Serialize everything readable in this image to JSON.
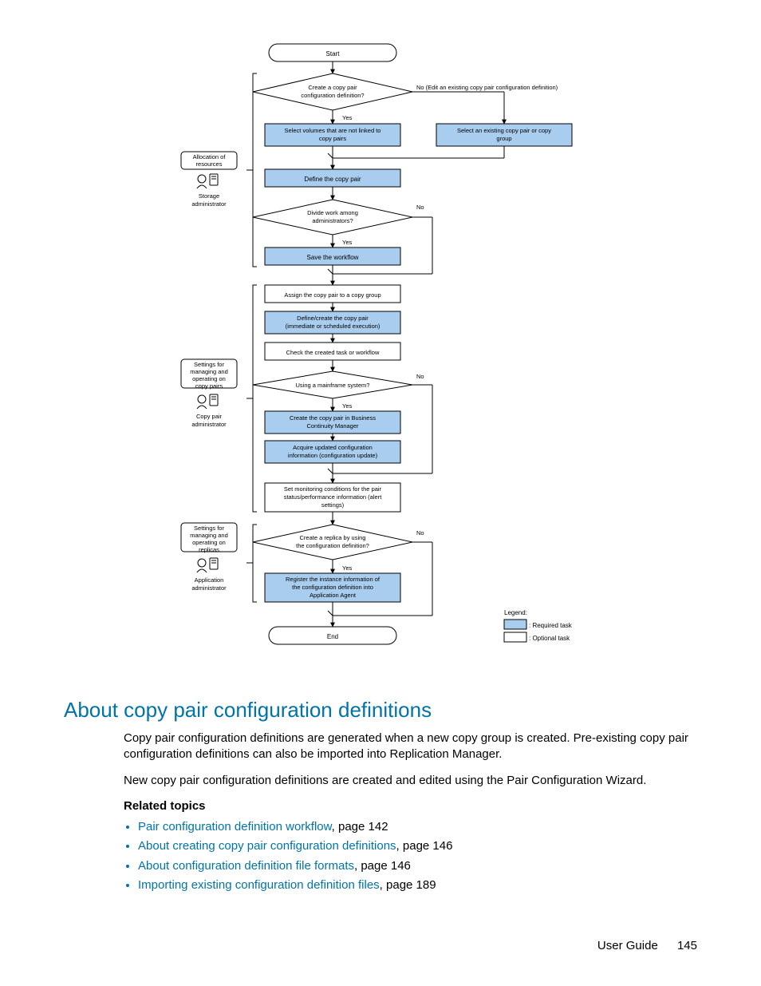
{
  "flowchart": {
    "start": "Start",
    "end": "End",
    "decisions": {
      "d1": "Create a copy pair\nconfiguration definition?",
      "d2": "Divide work among\nadministrators?",
      "d3": "Using a mainframe system?",
      "d4": "Create a replica by using\nthe configuration definition?"
    },
    "branch_labels": {
      "yes": "Yes",
      "no": "No"
    },
    "no_detail": "No (Edit an existing copy pair configuration definition)",
    "steps": {
      "s1": "Select volumes that are not linked to\ncopy pairs",
      "s2": "Select an existing copy pair or copy\ngroup",
      "s3": "Define the copy pair",
      "s4": "Save the workflow",
      "s5": "Assign the copy pair to a copy group",
      "s6": "Define/create the copy pair\n(immediate or scheduled execution)",
      "s7": "Check the created task or workflow",
      "s8": "Create the copy pair in Business\nContinuity Manager",
      "s9": "Acquire updated configuration\ninformation (configuration update)",
      "s10": "Set monitoring conditions for the pair\nstatus/performance information (alert\nsettings)",
      "s11": "Register the instance information of\nthe configuration definition into\nApplication Agent"
    },
    "roles": {
      "r1_box": "Allocation of\nresources",
      "r1_label": "Storage\nadministrator",
      "r2_box": "Settings for\nmanaging and\noperating on\ncopy pairs",
      "r2_label": "Copy pair\nadministrator",
      "r3_box": "Settings for\nmanaging and\noperating on\nreplicas",
      "r3_label": "Application\nadministrator"
    },
    "legend": {
      "title": "Legend:",
      "req": ": Required task",
      "opt": ": Optional task"
    }
  },
  "section": {
    "heading": "About copy pair configuration definitions",
    "p1": "Copy pair configuration definitions are generated when a new copy group is created. Pre-existing copy pair configuration definitions can also be imported into Replication Manager.",
    "p2": "New copy pair configuration definitions are created and edited using the Pair Configuration Wizard.",
    "related": "Related topics",
    "links": [
      {
        "text": "Pair configuration definition workflow",
        "page": "142"
      },
      {
        "text": "About creating copy pair configuration definitions",
        "page": "146"
      },
      {
        "text": "About configuration definition file formats",
        "page": "146"
      },
      {
        "text": "Importing existing configuration definition files",
        "page": "189"
      }
    ]
  },
  "footer": {
    "label": "User Guide",
    "page": "145"
  }
}
